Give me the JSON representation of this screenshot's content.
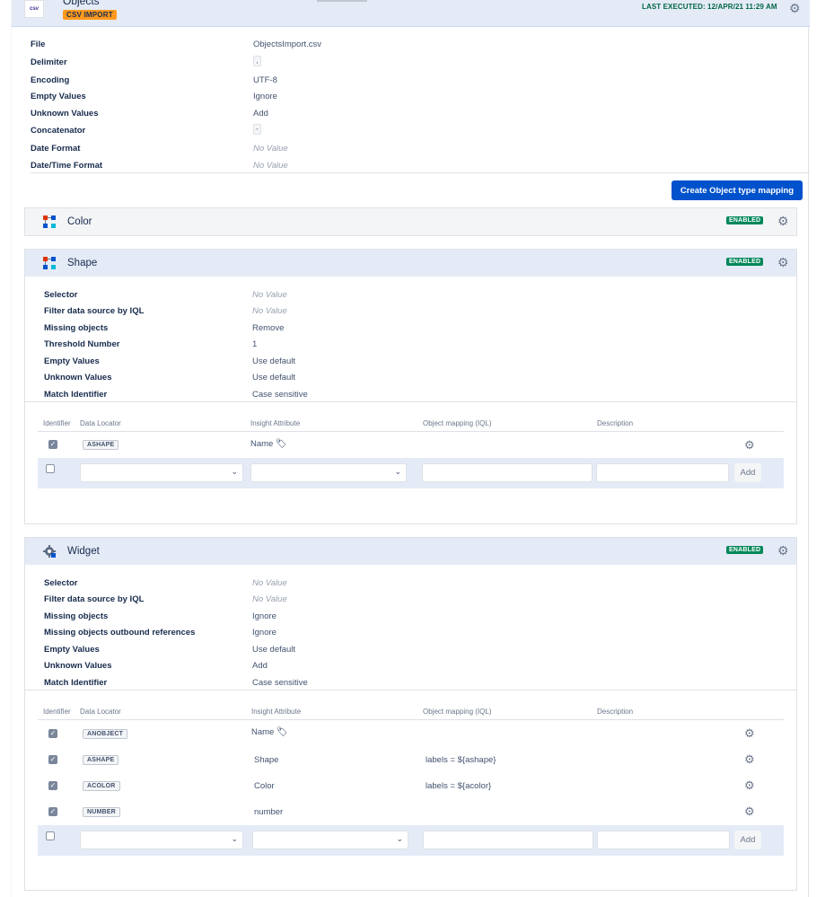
{
  "header": {
    "icon_text": "csv",
    "title": "Objects",
    "badge": "CSV IMPORT",
    "last_executed": "LAST EXECUTED: 12/APR/21 11:29 AM"
  },
  "config": [
    {
      "label": "File",
      "value": "ObjectsImport.csv"
    },
    {
      "label": "Delimiter",
      "value": ","
    },
    {
      "label": "Encoding",
      "value": "UTF-8"
    },
    {
      "label": "Empty Values",
      "value": "Ignore"
    },
    {
      "label": "Unknown Values",
      "value": "Add"
    },
    {
      "label": "Concatenator",
      "value": "-"
    },
    {
      "label": "Date Format",
      "value": "No Value"
    },
    {
      "label": "Date/Time Format",
      "value": "No Value"
    }
  ],
  "create_button": "Create Object type mapping",
  "columns": {
    "identifier": "Identifier",
    "data_locator": "Data Locator",
    "insight_attribute": "Insight Attribute",
    "object_mapping": "Object mapping (IQL)",
    "description": "Description",
    "add": "Add"
  },
  "color_panel": {
    "title": "Color",
    "status": "ENABLED"
  },
  "shape_panel": {
    "title": "Shape",
    "status": "ENABLED",
    "settings": [
      {
        "label": "Selector",
        "value": "No Value"
      },
      {
        "label": "Filter data source by IQL",
        "value": "No Value"
      },
      {
        "label": "Missing objects",
        "value": "Remove"
      },
      {
        "label": "Threshold Number",
        "value": "1"
      },
      {
        "label": "Empty Values",
        "value": "Use default"
      },
      {
        "label": "Unknown Values",
        "value": "Use default"
      },
      {
        "label": "Match Identifier",
        "value": "Case sensitive"
      }
    ],
    "mappings": [
      {
        "locator": "ASHAPE",
        "attribute": "Name",
        "iql": ""
      }
    ]
  },
  "widget_panel": {
    "title": "Widget",
    "status": "ENABLED",
    "settings": [
      {
        "label": "Selector",
        "value": "No Value"
      },
      {
        "label": "Filter data source by IQL",
        "value": "No Value"
      },
      {
        "label": "Missing objects",
        "value": "Ignore"
      },
      {
        "label": "Missing objects outbound references",
        "value": "Ignore"
      },
      {
        "label": "Empty Values",
        "value": "Use default"
      },
      {
        "label": "Unknown Values",
        "value": "Add"
      },
      {
        "label": "Match Identifier",
        "value": "Case sensitive"
      }
    ],
    "mappings": [
      {
        "locator": "ANOBJECT",
        "attribute": "Name",
        "iql": ""
      },
      {
        "locator": "ASHAPE",
        "attribute": "Shape",
        "iql": "labels = ${ashape}"
      },
      {
        "locator": "ACOLOR",
        "attribute": "Color",
        "iql": "labels = ${acolor}"
      },
      {
        "locator": "NUMBER",
        "attribute": "number",
        "iql": ""
      }
    ]
  },
  "colors": {
    "primary": "#0052cc",
    "enabled": "#00875a",
    "badge": "#ff991f",
    "header": "#e4ebf7"
  },
  "icons": [
    "gear-icon",
    "tag-icon",
    "object-type-icon",
    "checkbox-icon",
    "chevron-down-icon"
  ]
}
